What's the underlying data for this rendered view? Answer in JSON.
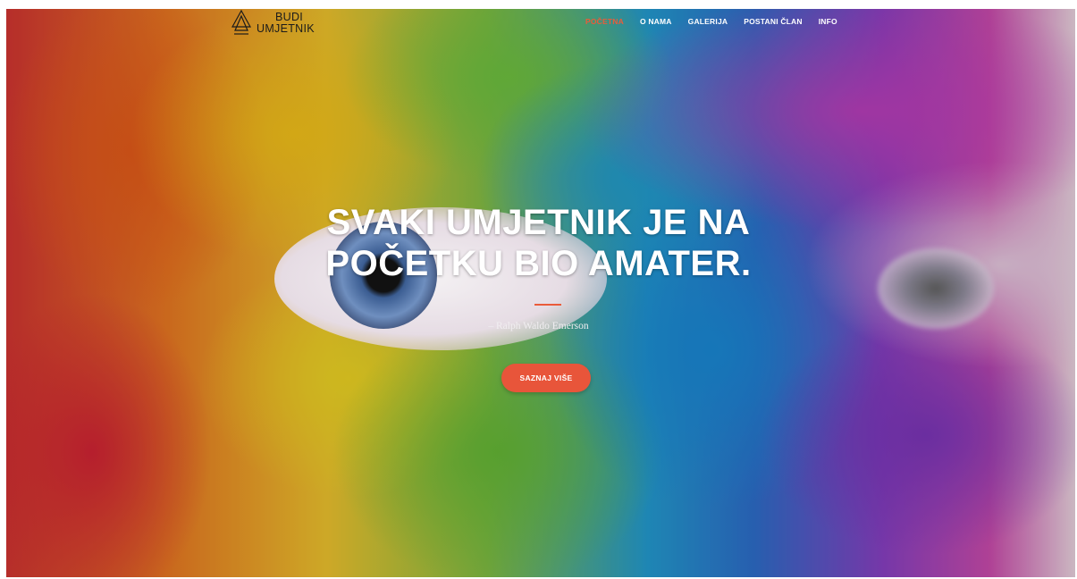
{
  "brand": {
    "line1": "BUDI",
    "line2": "UMJETNIK"
  },
  "nav": {
    "items": [
      "POČETNA",
      "O NAMA",
      "GALERIJA",
      "POSTANI ČLAN",
      "INFO"
    ],
    "active_index": 0
  },
  "hero": {
    "title_line1": "SVAKI UMJETNIK JE NA",
    "title_line2": "POČETKU BIO AMATER.",
    "quote": "– Ralph Waldo Emerson",
    "cta_label": "SAZNAJ VIŠE"
  },
  "colors": {
    "accent": "#e8553a",
    "nav_text": "#ffffff",
    "title_text": "#ffffff"
  },
  "icons": {
    "logo": "triangle-logo-icon"
  }
}
